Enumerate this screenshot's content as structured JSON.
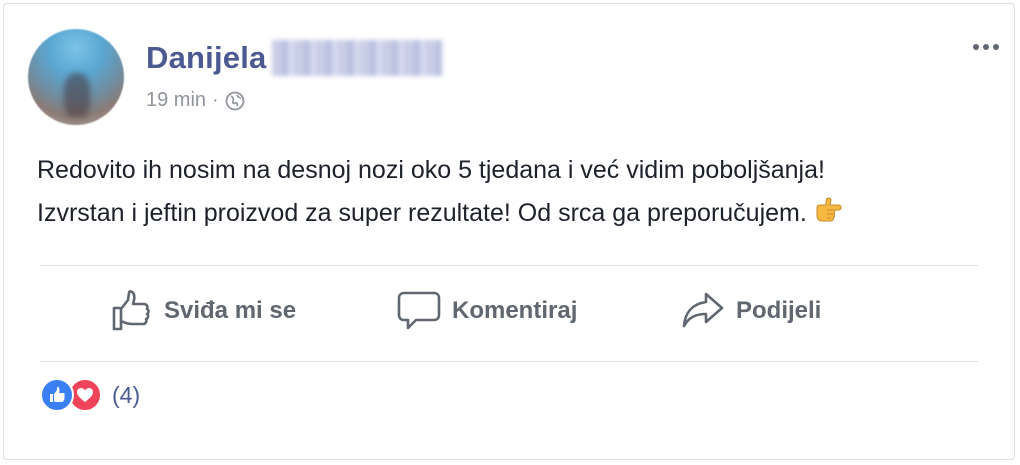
{
  "post": {
    "author_name": "Danijela",
    "timestamp": "19 min",
    "separator": "·",
    "audience_icon": "globe-icon",
    "more_icon": "more-options-icon",
    "text_line1": "Redovito ih nosim na desnoj nozi oko 5 tjedana i već vidim poboljšanja!",
    "text_line2": "Izvrstan i jeftin proizvod za super rezultate! Od srca ga preporučujem.",
    "emoji": "thumbs-right-emoji"
  },
  "actions": {
    "like_label": "Sviđa mi se",
    "comment_label": "Komentiraj",
    "share_label": "Podijeli"
  },
  "reactions": {
    "types": [
      "like",
      "love"
    ],
    "count_label": "(4)"
  },
  "colors": {
    "name": "#4b5a91",
    "meta": "#90949c",
    "action": "#606770",
    "like": "#3b7ff5",
    "love": "#f0445b",
    "divider": "#dadde1"
  }
}
